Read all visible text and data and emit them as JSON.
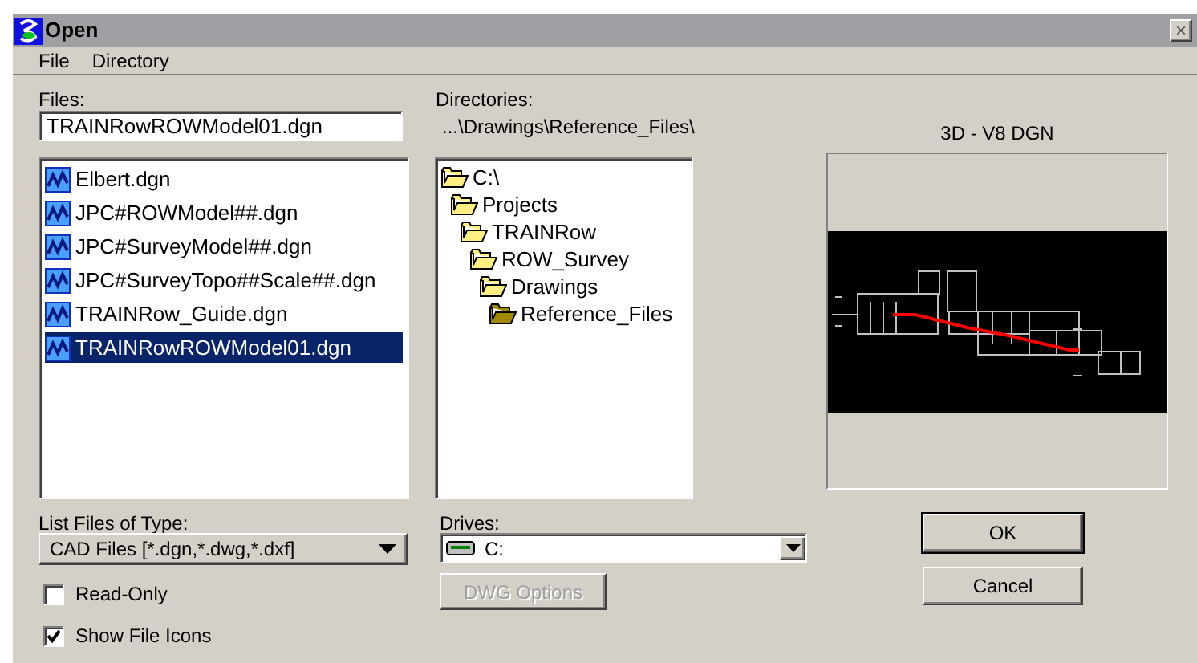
{
  "window": {
    "title": "Open",
    "close": "×"
  },
  "menu": [
    {
      "label": "File"
    },
    {
      "label": "Directory"
    }
  ],
  "files": {
    "label": "Files:",
    "value": "TRAINRowROWModel01.dgn",
    "items": [
      {
        "name": "Elbert.dgn",
        "selected": false
      },
      {
        "name": "JPC#ROWModel##.dgn",
        "selected": false
      },
      {
        "name": "JPC#SurveyModel##.dgn",
        "selected": false
      },
      {
        "name": "JPC#SurveyTopo##Scale##.dgn",
        "selected": false
      },
      {
        "name": "TRAINRow_Guide.dgn",
        "selected": false
      },
      {
        "name": "TRAINRowROWModel01.dgn",
        "selected": true
      }
    ]
  },
  "directories": {
    "label": "Directories:",
    "path": "...\\Drawings\\Reference_Files\\",
    "tree": [
      {
        "name": "C:\\",
        "current": false,
        "children": [
          {
            "name": "Projects",
            "current": false,
            "children": [
              {
                "name": "TRAINRow",
                "current": false,
                "children": [
                  {
                    "name": "ROW_Survey",
                    "current": false,
                    "children": [
                      {
                        "name": "Drawings",
                        "current": false,
                        "children": [
                          {
                            "name": "Reference_Files",
                            "current": true
                          }
                        ]
                      }
                    ]
                  }
                ]
              }
            ]
          }
        ]
      }
    ]
  },
  "preview": {
    "label": "3D - V8 DGN"
  },
  "file_type": {
    "label": "List Files of Type:",
    "value": "CAD Files [*.dgn,*.dwg,*.dxf]"
  },
  "drives": {
    "label": "Drives:",
    "value": "C:"
  },
  "dwg_options": {
    "label": "DWG Options",
    "disabled": true
  },
  "checkboxes": [
    {
      "label": "Read-Only",
      "checked": false
    },
    {
      "label": "Show File Icons",
      "checked": true
    }
  ],
  "buttons": [
    {
      "label": "OK",
      "default": true
    },
    {
      "label": "Cancel",
      "default": false
    }
  ]
}
